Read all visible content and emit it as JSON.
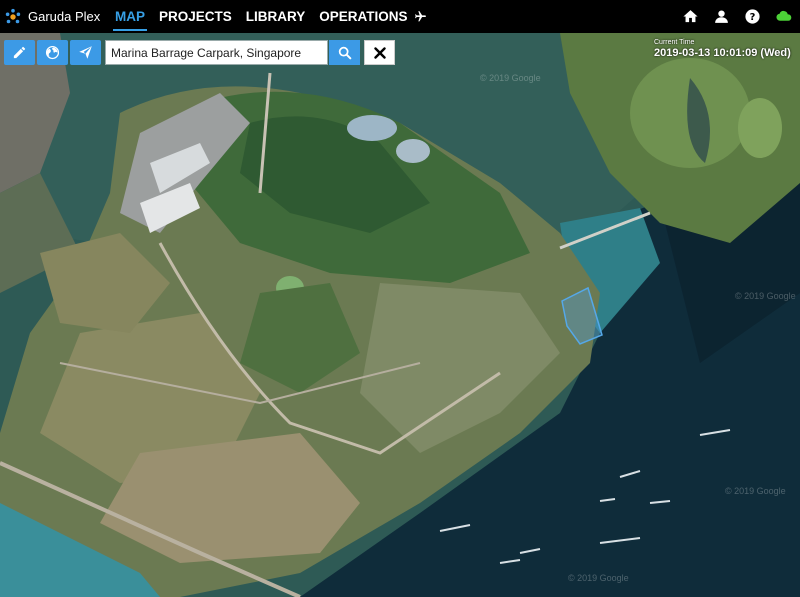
{
  "app": {
    "name": "Garuda Plex"
  },
  "nav": {
    "items": [
      {
        "label": "MAP",
        "active": true
      },
      {
        "label": "PROJECTS",
        "active": false
      },
      {
        "label": "LIBRARY",
        "active": false
      },
      {
        "label": "OPERATIONS",
        "active": false
      }
    ]
  },
  "toolbar": {
    "search_value": "Marina Barrage Carpark, Singapore",
    "tools": [
      "pencil-icon",
      "globe-icon",
      "paper-plane-icon"
    ]
  },
  "time": {
    "label": "Current Time",
    "value": "2019-03-13 10:01:09 (Wed)"
  },
  "map": {
    "watermark": "© 2019 Google"
  },
  "colors": {
    "accent": "#37a0e6",
    "button": "#3c9ae6",
    "cloud": "#4cd137",
    "topbar": "#000000"
  }
}
